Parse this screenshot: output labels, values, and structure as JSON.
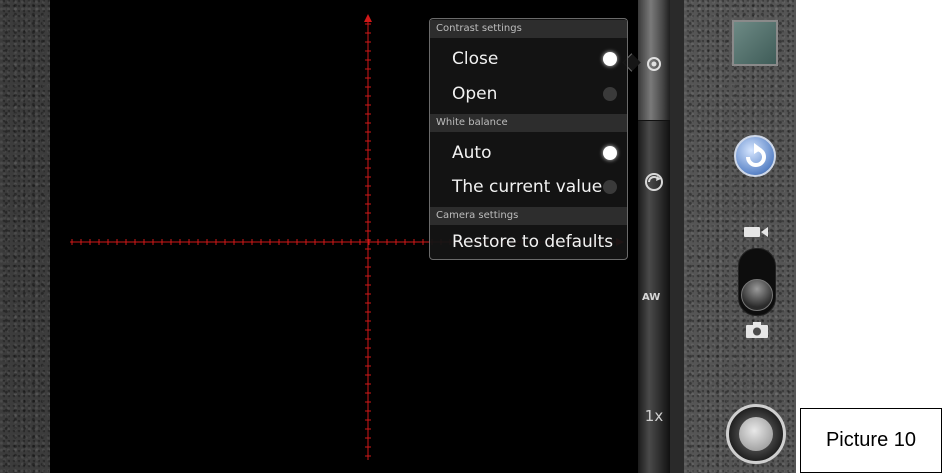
{
  "popup": {
    "sections": [
      {
        "header": "Contrast settings",
        "items": [
          {
            "label": "Close",
            "selected": true
          },
          {
            "label": "Open",
            "selected": false
          }
        ]
      },
      {
        "header": "White balance",
        "items": [
          {
            "label": "Auto",
            "selected": true
          },
          {
            "label": "The current value",
            "selected": false
          }
        ]
      },
      {
        "header": "Camera settings",
        "items": [
          {
            "label": "Restore to defaults"
          }
        ]
      }
    ]
  },
  "settings_bar": {
    "icons": [
      "contrast-icon",
      "rotate-settings-icon",
      "white-balance-auto-icon"
    ],
    "awb_label": "AW",
    "zoom_label": "1x"
  },
  "controls": {
    "icons": [
      "thumbnail",
      "switch-camera-icon",
      "video-icon",
      "mode-slider",
      "camera-icon",
      "shutter-button"
    ]
  },
  "caption": "Picture 10",
  "colors": {
    "crosshair": "#d01818",
    "selected_radio": "#ffffff",
    "popup_bg": "#141414"
  }
}
